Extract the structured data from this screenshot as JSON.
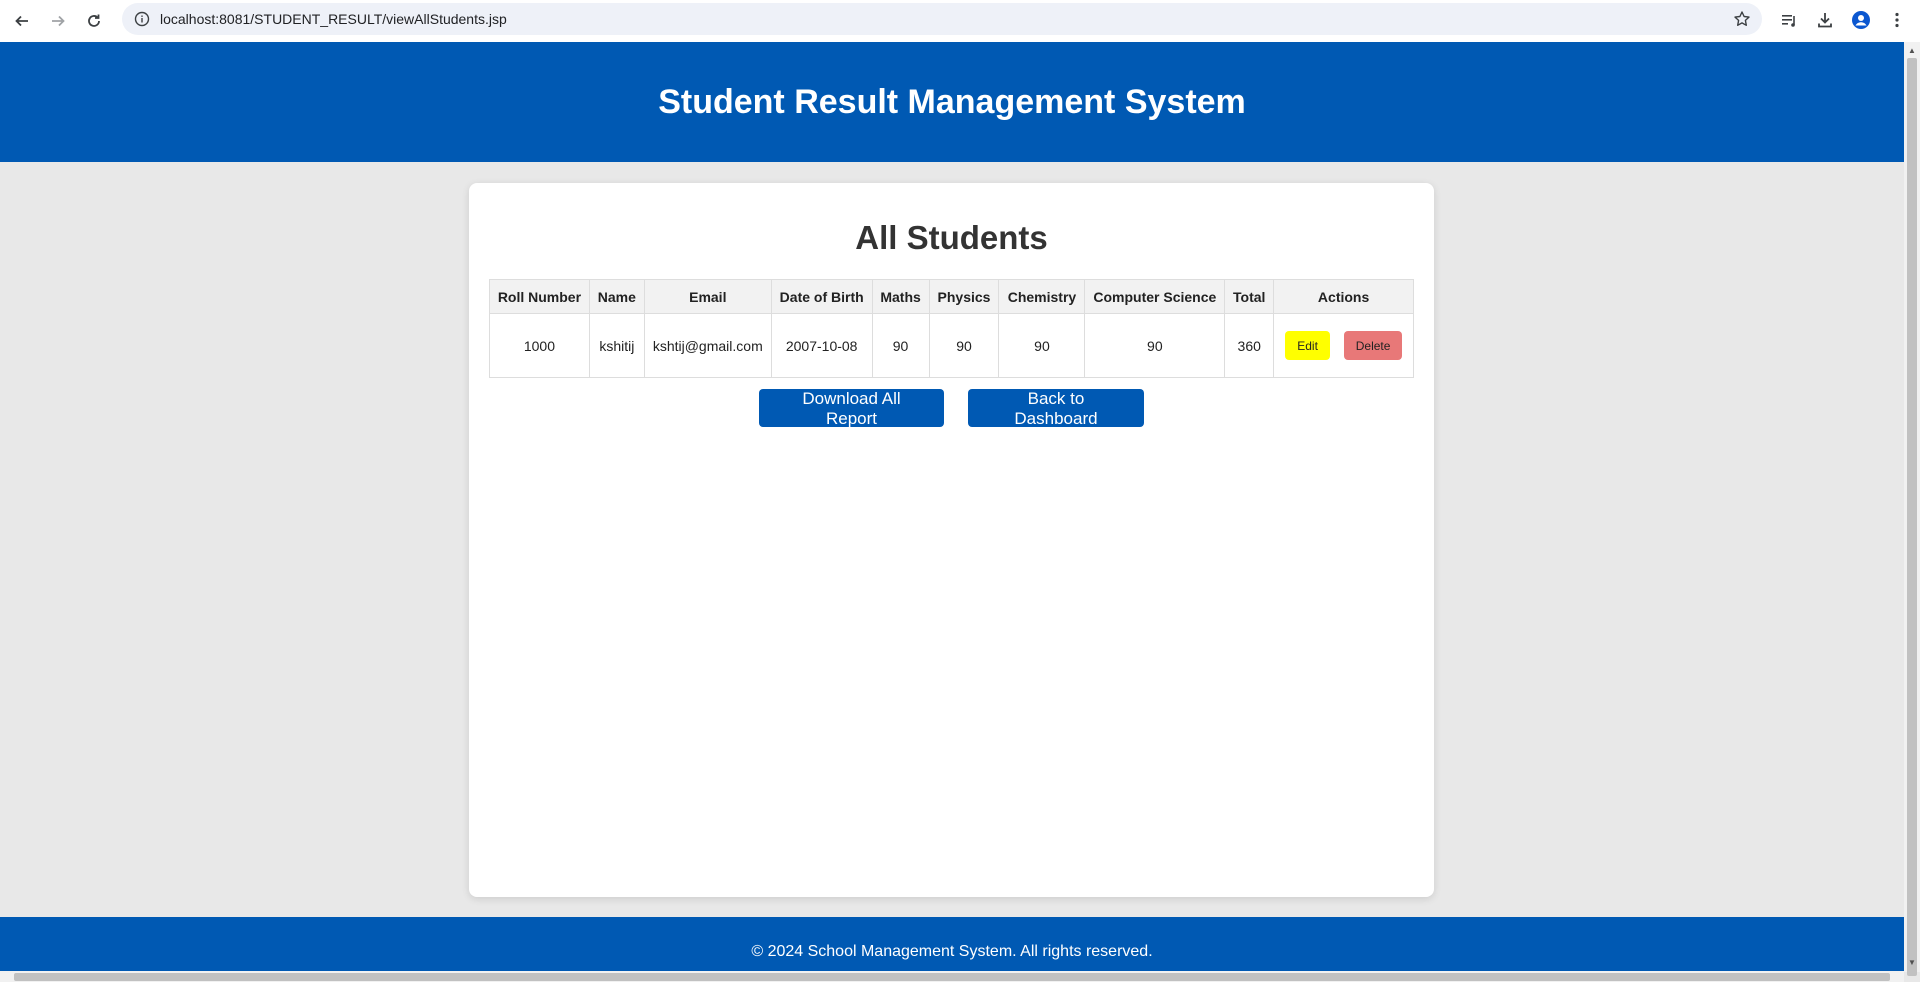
{
  "browser": {
    "url": "localhost:8081/STUDENT_RESULT/viewAllStudents.jsp"
  },
  "header": {
    "title": "Student Result Management System"
  },
  "main": {
    "title": "All Students",
    "table": {
      "columns": [
        "Roll Number",
        "Name",
        "Email",
        "Date of Birth",
        "Maths",
        "Physics",
        "Chemistry",
        "Computer Science",
        "Total",
        "Actions"
      ],
      "rows": [
        {
          "roll_number": "1000",
          "name": "kshitij",
          "email": "kshtij@gmail.com",
          "dob": "2007-10-08",
          "maths": "90",
          "physics": "90",
          "chemistry": "90",
          "computer_science": "90",
          "total": "360",
          "edit_label": "Edit",
          "delete_label": "Delete"
        }
      ]
    },
    "download_label": "Download All Report",
    "back_label": "Back to Dashboard"
  },
  "footer": {
    "text": "© 2024 School Management System. All rights reserved."
  },
  "colors": {
    "brand_blue": "#0059b3",
    "edit_yellow": "#ffff00",
    "delete_red": "#e87878",
    "page_bg": "#e8e8e8"
  }
}
